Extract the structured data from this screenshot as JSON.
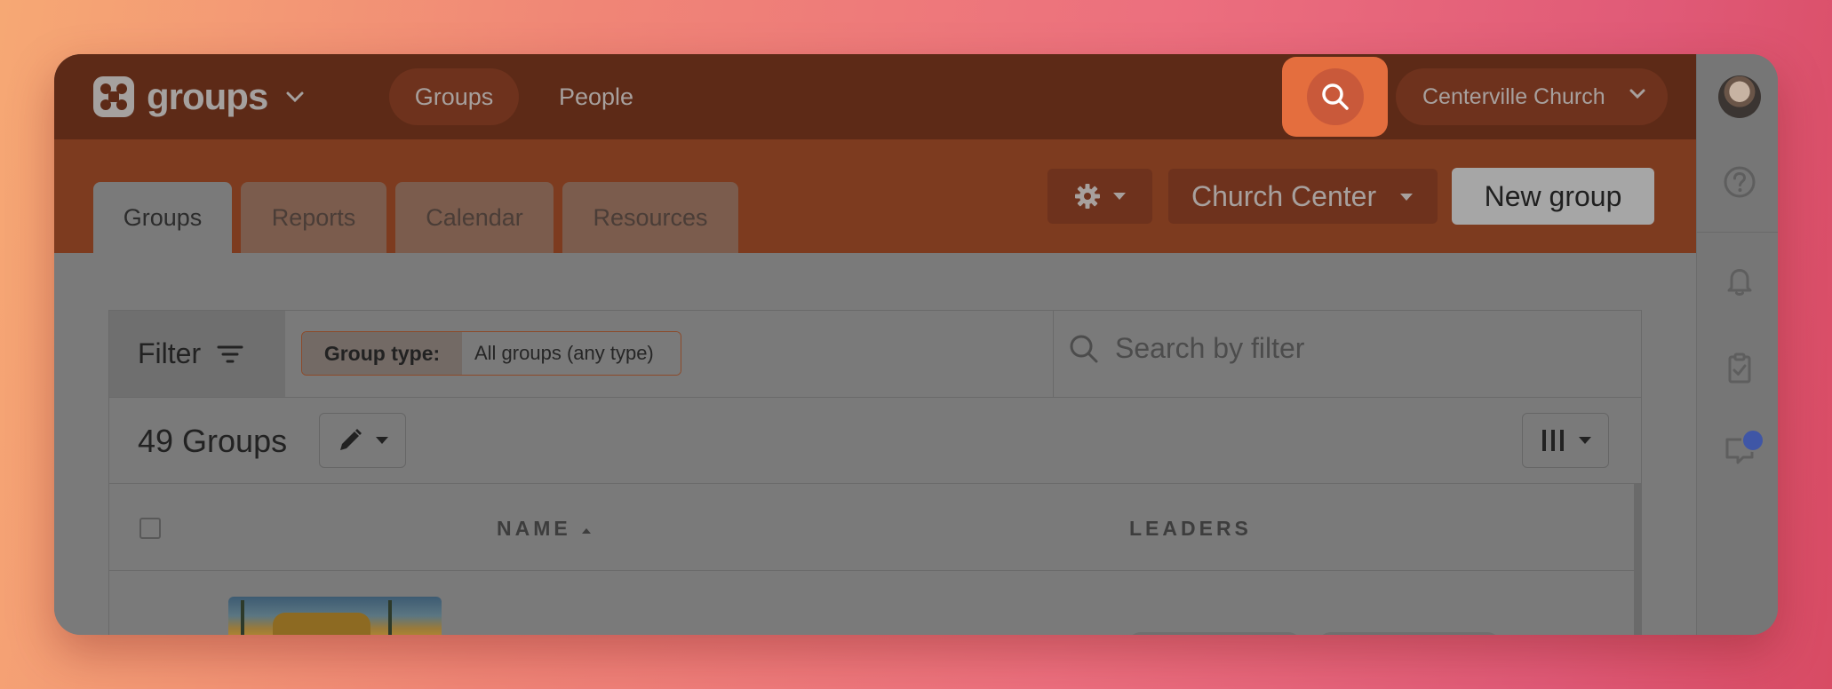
{
  "app": {
    "name": "groups"
  },
  "top_nav": {
    "items": [
      {
        "label": "Groups",
        "active": true
      },
      {
        "label": "People",
        "active": false
      }
    ]
  },
  "org_selector": {
    "label": "Centerville Church"
  },
  "tabs": [
    {
      "label": "Groups",
      "active": true
    },
    {
      "label": "Reports"
    },
    {
      "label": "Calendar"
    },
    {
      "label": "Resources"
    }
  ],
  "toolbar": {
    "church_center_label": "Church Center",
    "new_group_label": "New group"
  },
  "filter": {
    "label": "Filter",
    "chip_label": "Group type:",
    "chip_value": "All groups (any type)",
    "search_placeholder": "Search by filter"
  },
  "list": {
    "count_label": "49 Groups"
  },
  "table": {
    "columns": [
      "NAME",
      "LEADERS"
    ]
  },
  "colors": {
    "topbar": "#5d2a17",
    "subbar": "#7d3b1f",
    "search_accent": "#e46e3e",
    "notification_dot": "#3f56a6"
  }
}
